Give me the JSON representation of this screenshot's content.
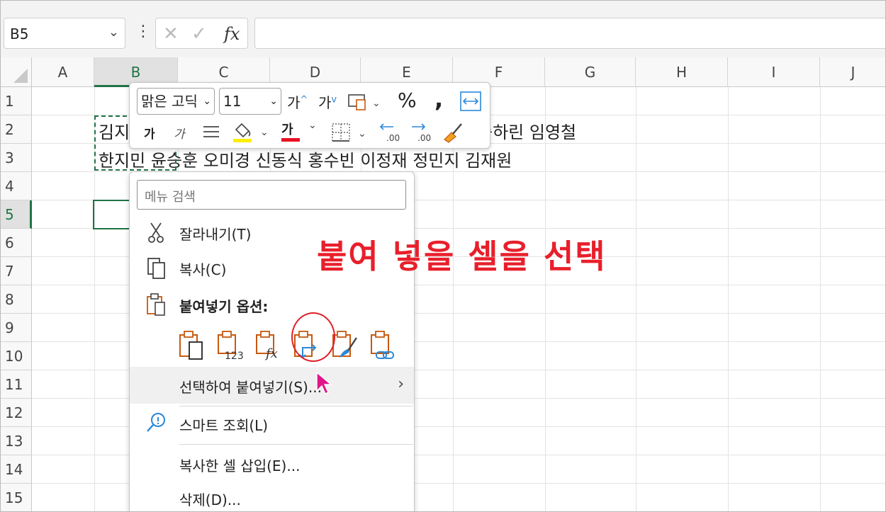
{
  "formula_bar": {
    "name_box": "B5",
    "fx_label": "fx",
    "formula": ""
  },
  "columns": [
    "A",
    "B",
    "C",
    "D",
    "E",
    "F",
    "G",
    "H",
    "I",
    "J"
  ],
  "rows": [
    "1",
    "2",
    "3",
    "4",
    "5",
    "6",
    "7",
    "8",
    "9",
    "10",
    "11",
    "12",
    "13",
    "14",
    "15"
  ],
  "cells": {
    "row2": "김지",
    "row2_right": "승하린 임영철",
    "row3": "한지민 윤승훈 오미경 신동식 홍수빈 이정재 정민지 김재원"
  },
  "mini_toolbar": {
    "font_name": "맑은 고딕",
    "font_size": "11",
    "grow_font": "가",
    "shrink_font": "가",
    "percent": "%",
    "comma": ",",
    "bold": "가",
    "italic": "가",
    "font_color_glyph": "가",
    "font_color_hex": "#e81123",
    "fill_color_hex": "#ffee00"
  },
  "context_menu": {
    "search_placeholder": "메뉴 검색",
    "cut": "잘라내기(T)",
    "copy": "복사(C)",
    "paste_options": "붙여넣기 옵션:",
    "paste_special": "선택하여 붙여넣기(S)...",
    "smart_lookup": "스마트 조회(L)",
    "insert_copied": "복사한 셀 삽입(E)...",
    "delete": "삭제(D)...",
    "paste_icons": [
      "paste-icon",
      "paste-values-icon",
      "paste-formulas-icon",
      "paste-transpose-icon",
      "paste-formatting-icon",
      "paste-link-icon"
    ],
    "paste_values_caption": "123",
    "paste_formulas_caption": "fx"
  },
  "annotation": {
    "text": "붙여 넣을 셀을 선택",
    "color": "#e81f2b"
  },
  "colors": {
    "accent_green": "#217346",
    "icon_orange": "#c55a11",
    "icon_blue": "#2b88d8"
  }
}
